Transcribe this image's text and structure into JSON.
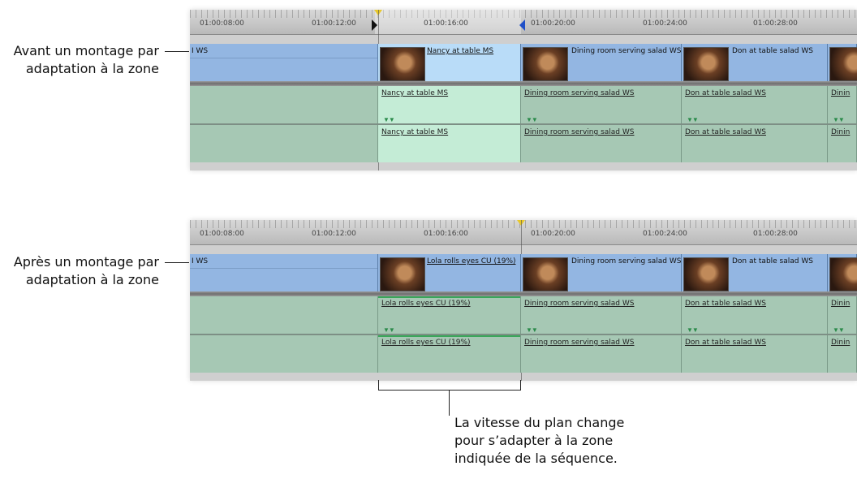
{
  "callouts": {
    "before": {
      "line1": "Avant un montage par",
      "line2": "adaptation à la zone"
    },
    "after": {
      "line1": "Après un montage par",
      "line2": "adaptation à la zone"
    }
  },
  "note": {
    "line1": "La vitesse du plan change",
    "line2": "pour s’adapter à la zone",
    "line3": "indiquée de la séquence."
  },
  "ruler_timecodes": [
    "01:00:08:00",
    "01:00:12:00",
    "01:00:16:00",
    "01:00:20:00",
    "01:00:24:00",
    "01:00:28:00"
  ],
  "before": {
    "video_clips": [
      "I WS",
      "Nancy at table MS",
      "Dining room serving salad WS",
      "Don at table salad WS"
    ],
    "audio_clips": [
      "Nancy at table MS",
      "Dining room serving salad WS",
      "Don at table salad WS",
      "Dinin"
    ]
  },
  "after": {
    "video_clips": [
      "I WS",
      "Lola rolls eyes CU (19%)",
      "Dining room serving salad WS",
      "Don at table salad WS"
    ],
    "audio_clips": [
      "Lola rolls eyes CU (19%)",
      "Dining room serving salad WS",
      "Don at table salad WS",
      "Dinin"
    ]
  },
  "colors": {
    "video_track": "#93b6e2",
    "video_selected": "#b9dcf8",
    "audio_track": "#a6c8b4",
    "audio_selected": "#c4ecd6",
    "playhead": "#e8c82a",
    "out_marker": "#2050c8"
  }
}
